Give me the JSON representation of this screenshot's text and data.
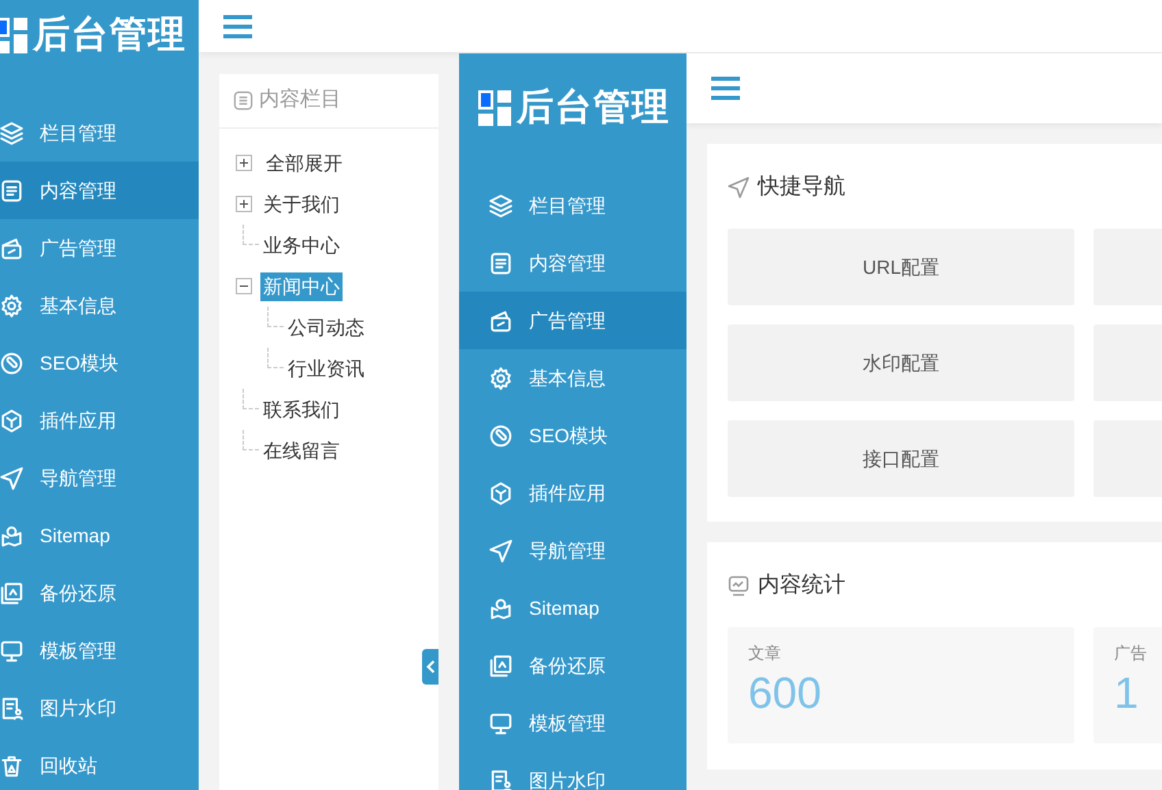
{
  "outer": {
    "logo": "后台管理",
    "sidebar": {
      "items": [
        {
          "label": "栏目管理",
          "selected": false
        },
        {
          "label": "内容管理",
          "selected": true
        },
        {
          "label": "广告管理",
          "selected": false
        },
        {
          "label": "基本信息",
          "selected": false
        },
        {
          "label": "SEO模块",
          "selected": false
        },
        {
          "label": "插件应用",
          "selected": false
        },
        {
          "label": "导航管理",
          "selected": false
        },
        {
          "label": "Sitemap",
          "selected": false
        },
        {
          "label": "备份还原",
          "selected": false
        },
        {
          "label": "模板管理",
          "selected": false
        },
        {
          "label": "图片水印",
          "selected": false
        },
        {
          "label": "回收站",
          "selected": false
        }
      ]
    },
    "tree_panel": {
      "title": "内容栏目",
      "expand_all": "全部展开",
      "items": [
        {
          "label": "关于我们",
          "selected": false,
          "expanded": false,
          "kind": "folder"
        },
        {
          "label": "业务中心",
          "selected": false,
          "kind": "leaf"
        },
        {
          "label": "新闻中心",
          "selected": true,
          "expanded": true,
          "kind": "folder",
          "children": [
            {
              "label": "公司动态",
              "selected": false,
              "kind": "leaf"
            },
            {
              "label": "行业资讯",
              "selected": false,
              "kind": "leaf"
            }
          ]
        },
        {
          "label": "联系我们",
          "selected": false,
          "kind": "leaf"
        },
        {
          "label": "在线留言",
          "selected": false,
          "kind": "leaf"
        }
      ]
    }
  },
  "inner": {
    "logo": "后台管理",
    "sidebar": {
      "items": [
        {
          "label": "栏目管理",
          "selected": false
        },
        {
          "label": "内容管理",
          "selected": false
        },
        {
          "label": "广告管理",
          "selected": true
        },
        {
          "label": "基本信息",
          "selected": false
        },
        {
          "label": "SEO模块",
          "selected": false
        },
        {
          "label": "插件应用",
          "selected": false
        },
        {
          "label": "导航管理",
          "selected": false
        },
        {
          "label": "Sitemap",
          "selected": false
        },
        {
          "label": "备份还原",
          "selected": false
        },
        {
          "label": "模板管理",
          "selected": false
        },
        {
          "label": "图片水印",
          "selected": false
        }
      ]
    },
    "quick_nav": {
      "title": "快捷导航",
      "tiles": [
        "URL配置",
        "水印配置",
        "接口配置"
      ]
    },
    "stats": {
      "title": "内容统计",
      "tiles": [
        {
          "label": "文章",
          "value": "600"
        },
        {
          "label": "广告",
          "value": "1"
        }
      ]
    }
  }
}
